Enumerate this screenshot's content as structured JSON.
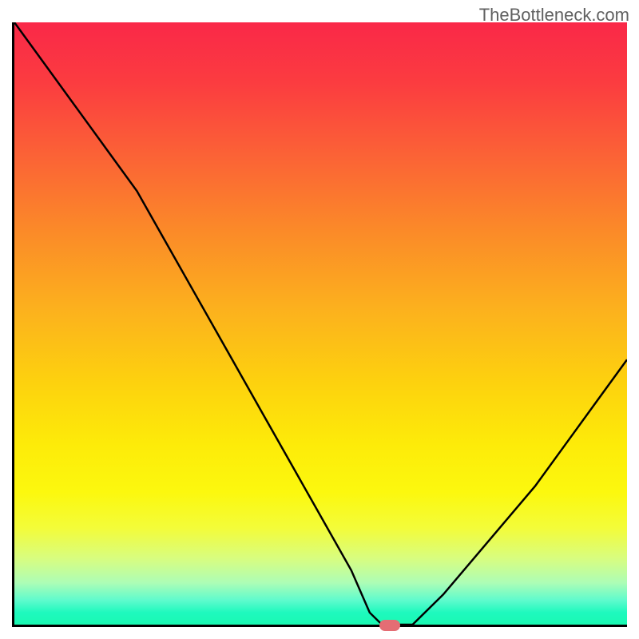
{
  "watermark": "TheBottleneck.com",
  "chart_data": {
    "type": "line",
    "title": "",
    "xlabel": "",
    "ylabel": "",
    "x": [
      0,
      5,
      10,
      15,
      20,
      25,
      30,
      35,
      40,
      45,
      50,
      55,
      58,
      60,
      62,
      65,
      70,
      75,
      80,
      85,
      90,
      95,
      100
    ],
    "values": [
      100,
      93,
      86,
      79,
      72,
      63,
      54,
      45,
      36,
      27,
      18,
      9,
      2,
      0,
      0,
      0,
      5,
      11,
      17,
      23,
      30,
      37,
      44
    ],
    "xlim": [
      0,
      100
    ],
    "ylim": [
      0,
      100
    ],
    "marker_position": {
      "x": 61,
      "y": 0
    },
    "gradient_colors": {
      "top": "#fa2848",
      "middle": "#fdd20e",
      "bottom": "#1af9b2"
    }
  }
}
